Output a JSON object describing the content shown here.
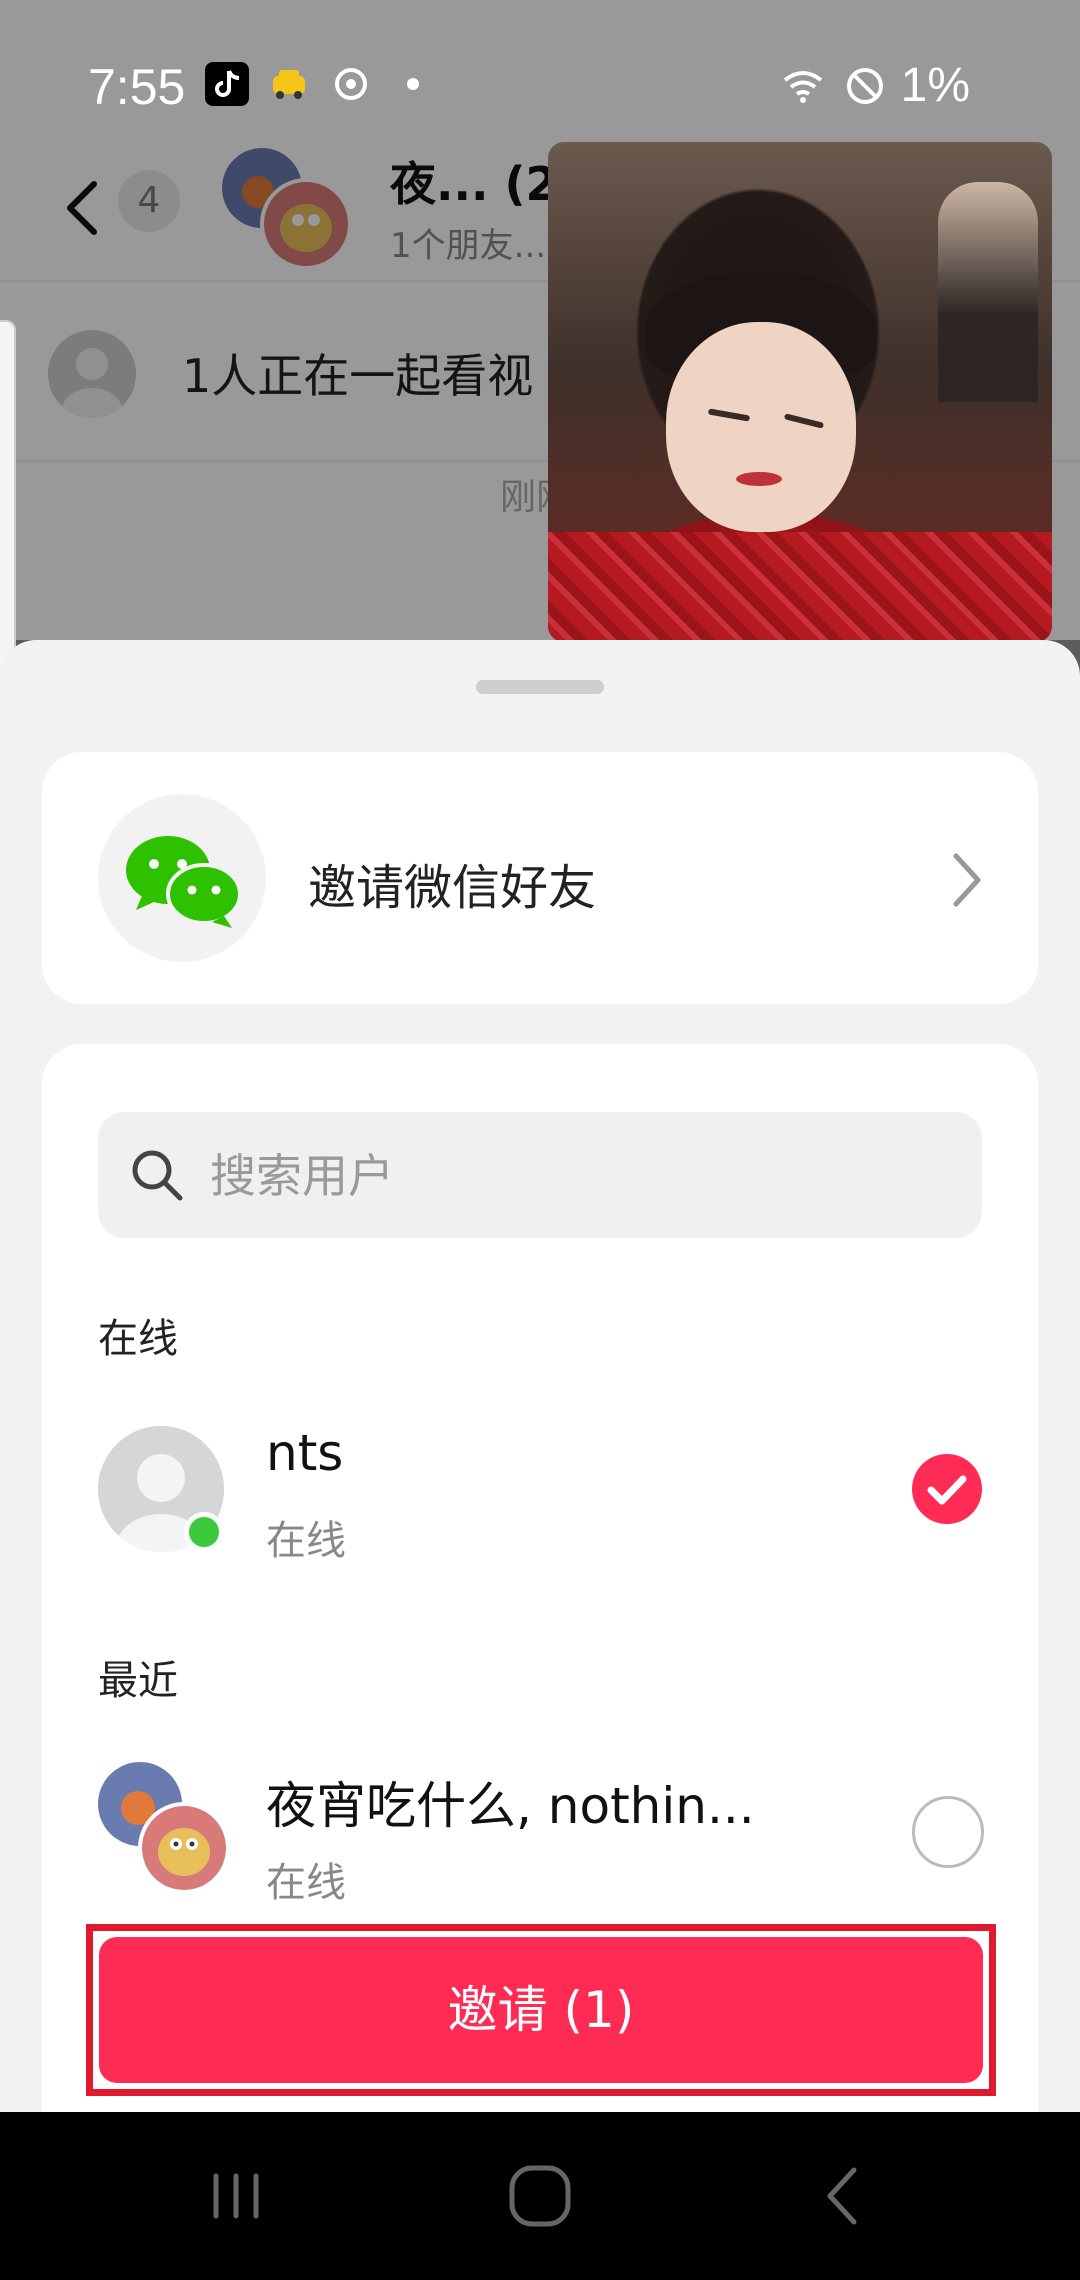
{
  "status_bar": {
    "time": "7:55",
    "battery": "1%",
    "icons": [
      "tiktok-icon",
      "taxi-icon",
      "sync-icon",
      "dot-icon",
      "wifi-icon",
      "dnd-icon"
    ]
  },
  "chat": {
    "unread_count": "4",
    "title": "夜... (2",
    "subtitle": "1个朋友...",
    "watching_text": "1人正在一起看视",
    "time_text": "刚刚"
  },
  "sheet": {
    "wechat_label": "邀请微信好友",
    "search_placeholder": "搜索用户",
    "section_online": "在线",
    "section_recent": "最近",
    "online_users": [
      {
        "name": "nts",
        "status": "在线",
        "selected": true
      }
    ],
    "recent_users": [
      {
        "name": "夜宵吃什么, nothin...",
        "status": "在线",
        "selected": false
      }
    ],
    "invite_button": "邀请 (1)"
  },
  "colors": {
    "accent": "#fe2c55",
    "online": "#3cc93c",
    "wechat": "#2dc100",
    "highlight_box": "#e0192f"
  }
}
